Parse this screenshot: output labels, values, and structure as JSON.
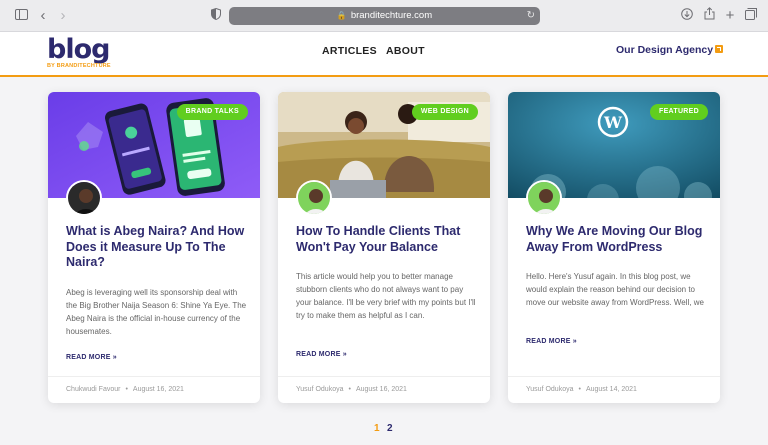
{
  "browser": {
    "url": "branditechture.com"
  },
  "header": {
    "logo_word": "blog",
    "logo_by": "BY BRANDITECHTURE",
    "nav": [
      "ARTICLES",
      "ABOUT"
    ],
    "agency_link": "Our Design Agency"
  },
  "posts": [
    {
      "badge": "BRAND TALKS",
      "title": "What is Abeg Naira? And How Does it Measure Up To The Naira?",
      "excerpt": "Abeg is leveraging well its sponsorship deal with the Big Brother Naija Season 6: Shine Ya Eye. The Abeg Naira is the official in-house currency of the housemates.",
      "read_more": "READ MORE »",
      "author": "Chukwudi Favour",
      "date": "August 16, 2021"
    },
    {
      "badge": "WEB DESIGN",
      "title": "How To Handle Clients That Won't Pay Your Balance",
      "excerpt": "This article would help you to better manage stubborn clients who do not always want to pay your balance. I'll be very brief with my points but I'll try to make them as helpful as I can.",
      "read_more": "READ MORE »",
      "author": "Yusuf Odukoya",
      "date": "August 16, 2021"
    },
    {
      "badge": "FEATURED",
      "title": "Why We Are Moving Our Blog Away From WordPress",
      "excerpt": "Hello. Here's Yusuf again. In this blog post, we would explain the reason behind our decision to move our website away from WordPress. Well, we",
      "read_more": "READ MORE »",
      "author": "Yusuf Odukoya",
      "date": "August 14, 2021"
    }
  ],
  "pagination": {
    "current": "1",
    "next": "2"
  },
  "colors": {
    "brand": "#2d2a6e",
    "accent": "#f39c12",
    "badge": "#61ce1f"
  }
}
